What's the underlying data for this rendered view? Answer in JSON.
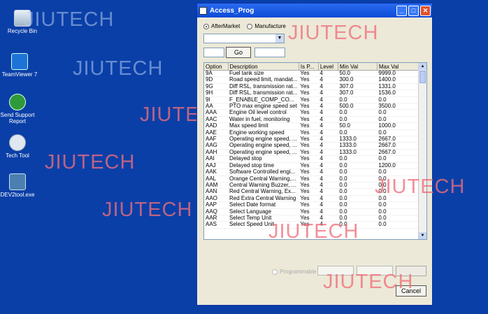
{
  "watermark": "JIUTECH",
  "desktop": {
    "icons": [
      {
        "label": "Recycle Bin",
        "icon": "recycle-bin-icon"
      },
      {
        "label": "TeamViewer 7",
        "icon": "teamviewer-icon"
      },
      {
        "label": "Send Support Report",
        "icon": "send-report-icon"
      },
      {
        "label": "Tech Tool",
        "icon": "tech-tool-icon"
      },
      {
        "label": "DEV2tool.exe",
        "icon": "dev2tool-icon"
      }
    ]
  },
  "window": {
    "title": "Access_Prog",
    "radio_aftermarket": "AfterMarket",
    "radio_manufacture": "Manufacture",
    "go_label": "Go",
    "programmable_label": "Programmable",
    "cancel_label": "Cancel"
  },
  "table": {
    "columns": [
      "Option",
      "Description",
      "Is P...",
      "Level",
      "Min Val",
      "Max Val"
    ],
    "rows": [
      [
        "9A",
        "Fuel tank size",
        "Yes",
        "4",
        "50.0",
        "9999.0"
      ],
      [
        "9D",
        "Road speed limit, mandat...",
        "Yes",
        "4",
        "300.0",
        "1400.0"
      ],
      [
        "9G",
        "Diff RSL, transmission rat...",
        "Yes",
        "4",
        "307.0",
        "1331.0"
      ],
      [
        "9H",
        "Diff RSL, transmission rat...",
        "Yes",
        "4",
        "307.0",
        "1536.0"
      ],
      [
        "9I",
        "F_ENABLE_COMP_CO...",
        "Yes",
        "4",
        "0.0",
        "0.0"
      ],
      [
        "AA",
        "PTO max engine speed set",
        "Yes",
        "4",
        "500.0",
        "3500.0"
      ],
      [
        "AAA",
        "Engine Oil level control",
        "Yes",
        "4",
        "0.0",
        "0.0"
      ],
      [
        "AAC",
        "Water in fuel, monitoring",
        "Yes",
        "4",
        "0.0",
        "0.0"
      ],
      [
        "AAD",
        "Max speed limit",
        "Yes",
        "4",
        "50.0",
        "1000.0"
      ],
      [
        "AAE",
        "Engine working speed",
        "Yes",
        "4",
        "0.0",
        "0.0"
      ],
      [
        "AAF",
        "Operating engine speed, ...",
        "Yes",
        "4",
        "1333.0",
        "2667.0"
      ],
      [
        "AAG",
        "Operating engine speed, ...",
        "Yes",
        "4",
        "1333.0",
        "2667.0"
      ],
      [
        "AAH",
        "Operating engine speed, ...",
        "Yes",
        "4",
        "1333.0",
        "2667.0"
      ],
      [
        "AAI",
        "Delayed stop",
        "Yes",
        "4",
        "0.0",
        "0.0"
      ],
      [
        "AAJ",
        "Delayed stop time",
        "Yes",
        "4",
        "0.0",
        "1200.0"
      ],
      [
        "AAK",
        "Software Controlled engi...",
        "Yes",
        "4",
        "0.0",
        "0.0"
      ],
      [
        "AAL",
        "Orange Central Warning,...",
        "Yes",
        "4",
        "0.0",
        "0.0"
      ],
      [
        "AAM",
        "Central Warning Buzzer, ...",
        "Yes",
        "4",
        "0.0",
        "0.0"
      ],
      [
        "AAN",
        "Red Central Warning, Ex...",
        "Yes",
        "4",
        "0.0",
        "0.0"
      ],
      [
        "AAO",
        "Red Extra Central Warning",
        "Yes",
        "4",
        "0.0",
        "0.0"
      ],
      [
        "AAP",
        "Select Date format",
        "Yes",
        "4",
        "0.0",
        "0.0"
      ],
      [
        "AAQ",
        "Select Language",
        "Yes",
        "4",
        "0.0",
        "0.0"
      ],
      [
        "AAR",
        "Select Temp Unit",
        "Yes",
        "4",
        "0.0",
        "0.0"
      ],
      [
        "AAS",
        "Select Speed Unit",
        "Yes",
        "4",
        "0.0",
        "0.0"
      ]
    ]
  }
}
